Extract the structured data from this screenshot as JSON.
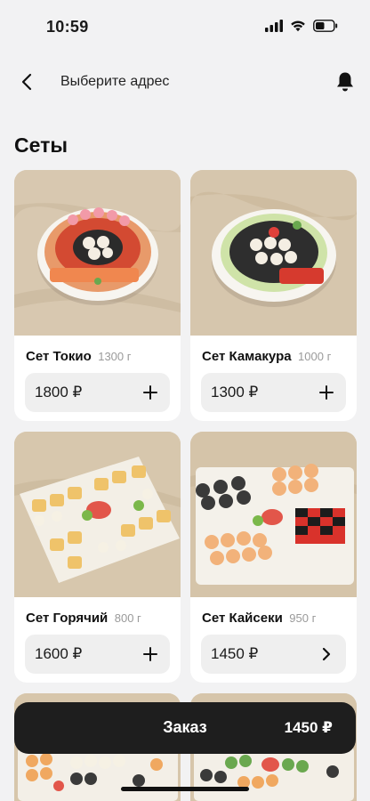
{
  "status": {
    "time": "10:59"
  },
  "nav": {
    "address_label": "Выберите адрес"
  },
  "section": {
    "title": "Сеты"
  },
  "products": [
    {
      "name": "Сет Токио",
      "weight": "1300 г",
      "price": "1800 ₽",
      "action_icon": "plus-icon"
    },
    {
      "name": "Сет Камакура",
      "weight": "1000 г",
      "price": "1300 ₽",
      "action_icon": "plus-icon"
    },
    {
      "name": "Сет Горячий",
      "weight": "800 г",
      "price": "1600 ₽",
      "action_icon": "plus-icon"
    },
    {
      "name": "Сет Кайсеки",
      "weight": "950 г",
      "price": "1450 ₽",
      "action_icon": "chevron-right-icon"
    }
  ],
  "order": {
    "label": "Заказ",
    "total": "1450 ₽"
  },
  "colors": {
    "background": "#f2f2f3",
    "card": "#ffffff",
    "price_button": "#efefef",
    "order_bar": "#1e1e1e"
  }
}
